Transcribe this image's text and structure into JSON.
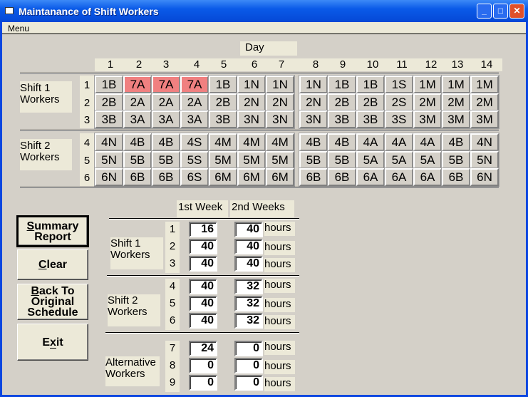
{
  "window": {
    "title": "Maintanance of Shift Workers",
    "menu": "Menu"
  },
  "schedule": {
    "day_label": "Day",
    "days": [
      "1",
      "2",
      "3",
      "4",
      "5",
      "6",
      "7",
      "8",
      "9",
      "10",
      "11",
      "12",
      "13",
      "14"
    ],
    "groups": [
      {
        "label": "Shift 1\nWorkers",
        "rows": [
          {
            "num": "1",
            "cells": [
              "1B",
              "7A",
              "7A",
              "7A",
              "1B",
              "1N",
              "1N",
              "1N",
              "1B",
              "1B",
              "1S",
              "1M",
              "1M",
              "1M"
            ]
          },
          {
            "num": "2",
            "cells": [
              "2B",
              "2A",
              "2A",
              "2A",
              "2B",
              "2N",
              "2N",
              "2N",
              "2B",
              "2B",
              "2S",
              "2M",
              "2M",
              "2M"
            ]
          },
          {
            "num": "3",
            "cells": [
              "3B",
              "3A",
              "3A",
              "3A",
              "3B",
              "3N",
              "3N",
              "3N",
              "3B",
              "3B",
              "3S",
              "3M",
              "3M",
              "3M"
            ]
          }
        ]
      },
      {
        "label": "Shift 2\nWorkers",
        "rows": [
          {
            "num": "4",
            "cells": [
              "4N",
              "4B",
              "4B",
              "4S",
              "4M",
              "4M",
              "4M",
              "4B",
              "4B",
              "4A",
              "4A",
              "4A",
              "4B",
              "4N"
            ]
          },
          {
            "num": "5",
            "cells": [
              "5N",
              "5B",
              "5B",
              "5S",
              "5M",
              "5M",
              "5M",
              "5B",
              "5B",
              "5A",
              "5A",
              "5A",
              "5B",
              "5N"
            ]
          },
          {
            "num": "6",
            "cells": [
              "6N",
              "6B",
              "6B",
              "6S",
              "6M",
              "6M",
              "6M",
              "6B",
              "6B",
              "6A",
              "6A",
              "6A",
              "6B",
              "6N"
            ]
          }
        ]
      }
    ],
    "highlight": {
      "color": "#f08080",
      "cells": [
        [
          0,
          1
        ],
        [
          0,
          2
        ],
        [
          0,
          3
        ]
      ]
    }
  },
  "buttons": [
    {
      "label": "Summary\nReport",
      "accel": "S",
      "name": "summary-report-button"
    },
    {
      "label": "Clear",
      "accel": "C",
      "name": "clear-button"
    },
    {
      "label": "Back To\nOriginal\nSchedule",
      "accel": "B",
      "name": "back-to-original-schedule-button"
    },
    {
      "label": "Exit",
      "accel": "x",
      "name": "exit-button"
    }
  ],
  "summary": {
    "col1": "1st Week",
    "col2": "2nd Weeks",
    "unit": "hours",
    "groups": [
      {
        "label": "Shift 1\nWorkers",
        "rows": [
          {
            "num": "1",
            "w1": "16",
            "w2": "40"
          },
          {
            "num": "2",
            "w1": "40",
            "w2": "40"
          },
          {
            "num": "3",
            "w1": "40",
            "w2": "40"
          }
        ]
      },
      {
        "label": "Shift 2\nWorkers",
        "rows": [
          {
            "num": "4",
            "w1": "40",
            "w2": "32"
          },
          {
            "num": "5",
            "w1": "40",
            "w2": "32"
          },
          {
            "num": "6",
            "w1": "40",
            "w2": "32"
          }
        ]
      },
      {
        "label": "Alternative\nWorkers",
        "rows": [
          {
            "num": "7",
            "w1": "24",
            "w2": "0"
          },
          {
            "num": "8",
            "w1": "0",
            "w2": "0"
          },
          {
            "num": "9",
            "w1": "0",
            "w2": "0"
          }
        ]
      }
    ]
  }
}
